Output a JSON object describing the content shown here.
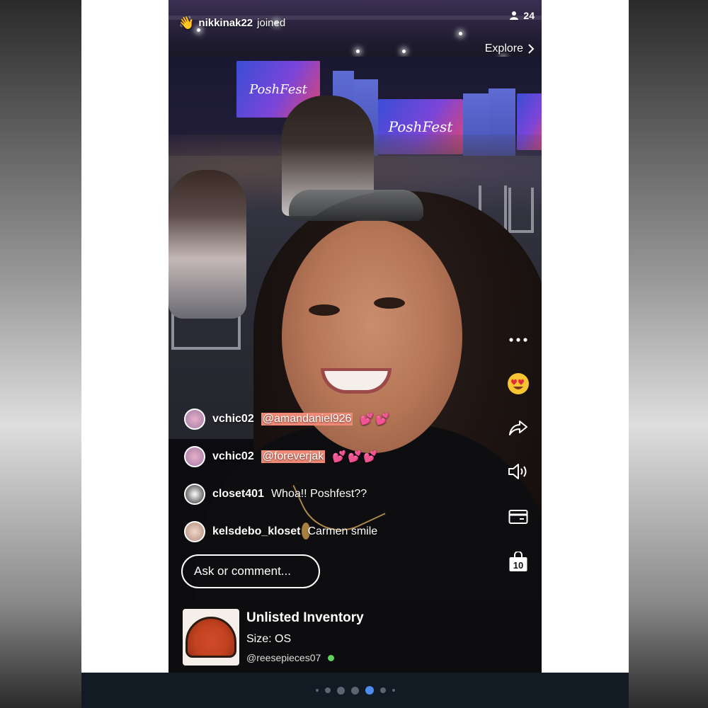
{
  "stream": {
    "join_user": "nikkinak22",
    "join_text": "joined",
    "viewer_count": "24",
    "explore_label": "Explore",
    "screen_text": "PoshFest"
  },
  "sidebar": {
    "more_icon": "more-dots-icon",
    "reaction_icon": "heart-eyes-emoji-icon",
    "share_icon": "share-arrow-icon",
    "sound_icon": "speaker-icon",
    "payment_icon": "card-icon",
    "bag_count": "10"
  },
  "comments": [
    {
      "user": "vchic02",
      "mention": "@amandaniel926",
      "text": "",
      "hearts": "💕💕"
    },
    {
      "user": "vchic02",
      "mention": "@foreverjak",
      "text": "",
      "hearts": "💕💕💕"
    },
    {
      "user": "closet401",
      "mention": "",
      "text": "Whoa!! Poshfest??",
      "hearts": ""
    },
    {
      "user": "kelsdebo_kloset",
      "mention": "",
      "text": "Carmen smile",
      "hearts": ""
    }
  ],
  "comment_input": {
    "placeholder": "Ask or comment..."
  },
  "product": {
    "title": "Unlisted Inventory",
    "size": "Size: OS",
    "seller": "@reesepieces07"
  },
  "pagination": {
    "total": 7,
    "active_index": 4
  },
  "colors": {
    "accent_mention": "#f08a76",
    "online": "#5ed35e",
    "active_dot": "#4f8cf0"
  }
}
